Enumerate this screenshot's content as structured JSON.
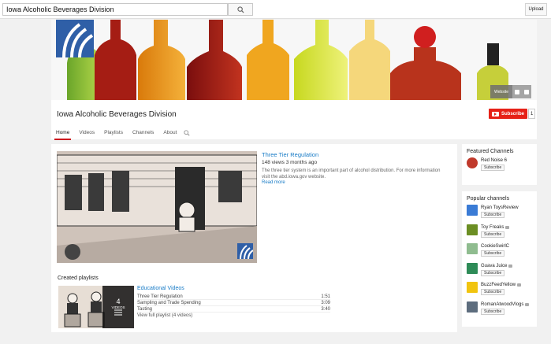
{
  "topbar": {
    "search_value": "Iowa Alcoholic Beverages Division",
    "upload_label": "Upload"
  },
  "banner": {
    "website_link": "Website"
  },
  "channel": {
    "title": "Iowa Alcoholic Beverages Division",
    "subscribe_label": "Subscribe",
    "subscriber_count": "1",
    "tabs": [
      "Home",
      "Videos",
      "Playlists",
      "Channels",
      "About"
    ],
    "active_tab": "Home"
  },
  "featured_video": {
    "title": "Three Tier Regulation",
    "meta": "148 views  3 months ago",
    "description": "The three tier system is an important part of alcohol distribution. For more information visit the abd.iowa.gov website.",
    "read_more": "Read more"
  },
  "playlists": {
    "heading": "Created playlists",
    "count": "4",
    "count_label": "VIDEOS",
    "title": "Educational Videos",
    "items": [
      {
        "title": "Three Tier Regulation",
        "duration": "1:51"
      },
      {
        "title": "Sampling and Trade Spending",
        "duration": "3:09"
      },
      {
        "title": "Tasting",
        "duration": "3:40"
      }
    ],
    "view_full": "View full playlist (4 videos)"
  },
  "featured_channels": {
    "heading": "Featured Channels",
    "items": [
      {
        "name": "Red Noise 6",
        "subscribe": "Subscribe",
        "color": "#c0392b"
      }
    ]
  },
  "popular_channels": {
    "heading": "Popular channels",
    "items": [
      {
        "name": "Ryan ToysReview",
        "subscribe": "Subscribe",
        "color": "#3a7bd5"
      },
      {
        "name": "Toy Freaks",
        "subscribe": "Subscribe",
        "color": "#6b8e23"
      },
      {
        "name": "CookieSwirlC",
        "subscribe": "Subscribe",
        "color": "#8fbc8f"
      },
      {
        "name": "Guava Juice",
        "subscribe": "Subscribe",
        "color": "#2e8b57"
      },
      {
        "name": "BuzzFeedYellow",
        "subscribe": "Subscribe",
        "color": "#f1c40f"
      },
      {
        "name": "RomanAtwoodVlogs",
        "subscribe": "Subscribe",
        "color": "#5d6d7e"
      }
    ]
  },
  "colors": {
    "accent_red": "#e62117",
    "link_blue": "#167ac6",
    "brand_blue": "#2f5fa7"
  }
}
